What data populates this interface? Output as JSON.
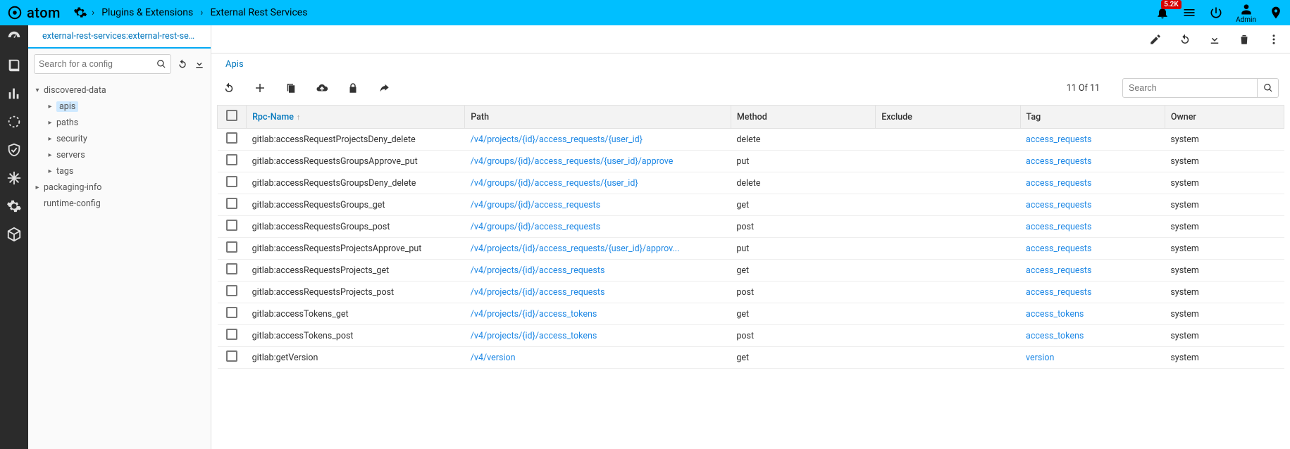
{
  "app": {
    "name": "atom"
  },
  "breadcrumbs": {
    "a": "Plugins & Extensions",
    "b": "External Rest Services"
  },
  "topbar": {
    "notif_badge": "5.2K",
    "user_label": "Admin"
  },
  "explorer": {
    "tab": "external-rest-services:external-rest-services",
    "search_placeholder": "Search for a config",
    "tree": {
      "discovered": "discovered-data",
      "apis": "apis",
      "paths": "paths",
      "security": "security",
      "servers": "servers",
      "tags": "tags",
      "packaging": "packaging-info",
      "runtime": "runtime-config"
    }
  },
  "panel": {
    "title": "Apis",
    "count_text": "11 Of 11",
    "search_placeholder": "Search"
  },
  "columns": {
    "rpc": "Rpc-Name",
    "path": "Path",
    "method": "Method",
    "exclude": "Exclude",
    "tag": "Tag",
    "owner": "Owner"
  },
  "rows": [
    {
      "rpc": "gitlab:accessRequestProjectsDeny_delete",
      "path": "/v4/projects/{id}/access_requests/{user_id}",
      "method": "delete",
      "exclude": "",
      "tag": "access_requests",
      "owner": "system"
    },
    {
      "rpc": "gitlab:accessRequestsGroupsApprove_put",
      "path": "/v4/groups/{id}/access_requests/{user_id}/approve",
      "method": "put",
      "exclude": "",
      "tag": "access_requests",
      "owner": "system"
    },
    {
      "rpc": "gitlab:accessRequestsGroupsDeny_delete",
      "path": "/v4/groups/{id}/access_requests/{user_id}",
      "method": "delete",
      "exclude": "",
      "tag": "access_requests",
      "owner": "system"
    },
    {
      "rpc": "gitlab:accessRequestsGroups_get",
      "path": "/v4/groups/{id}/access_requests",
      "method": "get",
      "exclude": "",
      "tag": "access_requests",
      "owner": "system"
    },
    {
      "rpc": "gitlab:accessRequestsGroups_post",
      "path": "/v4/groups/{id}/access_requests",
      "method": "post",
      "exclude": "",
      "tag": "access_requests",
      "owner": "system"
    },
    {
      "rpc": "gitlab:accessRequestsProjectsApprove_put",
      "path": "/v4/projects/{id}/access_requests/{user_id}/approv...",
      "method": "put",
      "exclude": "",
      "tag": "access_requests",
      "owner": "system"
    },
    {
      "rpc": "gitlab:accessRequestsProjects_get",
      "path": "/v4/projects/{id}/access_requests",
      "method": "get",
      "exclude": "",
      "tag": "access_requests",
      "owner": "system"
    },
    {
      "rpc": "gitlab:accessRequestsProjects_post",
      "path": "/v4/projects/{id}/access_requests",
      "method": "post",
      "exclude": "",
      "tag": "access_requests",
      "owner": "system"
    },
    {
      "rpc": "gitlab:accessTokens_get",
      "path": "/v4/projects/{id}/access_tokens",
      "method": "get",
      "exclude": "",
      "tag": "access_tokens",
      "owner": "system"
    },
    {
      "rpc": "gitlab:accessTokens_post",
      "path": "/v4/projects/{id}/access_tokens",
      "method": "post",
      "exclude": "",
      "tag": "access_tokens",
      "owner": "system"
    },
    {
      "rpc": "gitlab:getVersion",
      "path": "/v4/version",
      "method": "get",
      "exclude": "",
      "tag": "version",
      "owner": "system"
    }
  ]
}
